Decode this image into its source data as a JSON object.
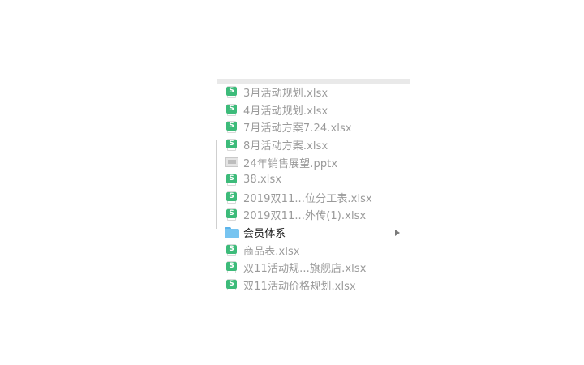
{
  "file_column": {
    "items": [
      {
        "name": "3月活动规划.xlsx",
        "icon": "spreadsheet-icon",
        "icon_glyph": "S"
      },
      {
        "name": "4月活动规划.xlsx",
        "icon": "spreadsheet-icon",
        "icon_glyph": "S"
      },
      {
        "name": "7月活动方案7.24.xlsx",
        "icon": "spreadsheet-icon",
        "icon_glyph": "S"
      },
      {
        "name": "8月活动方案.xlsx",
        "icon": "spreadsheet-icon",
        "icon_glyph": "S"
      },
      {
        "name": "24年销售展望.pptx",
        "icon": "presentation-icon"
      },
      {
        "name": "38.xlsx",
        "icon": "spreadsheet-icon",
        "icon_glyph": "S"
      },
      {
        "name": "2019双11...位分工表.xlsx",
        "icon": "spreadsheet-icon",
        "icon_glyph": "S"
      },
      {
        "name": "2019双11...外传(1).xlsx",
        "icon": "spreadsheet-icon",
        "icon_glyph": "S"
      },
      {
        "name": "会员体系",
        "icon": "folder-icon",
        "has_children": true
      },
      {
        "name": "商品表.xlsx",
        "icon": "spreadsheet-icon",
        "icon_glyph": "S"
      },
      {
        "name": "双11活动规...旗舰店.xlsx",
        "icon": "spreadsheet-icon",
        "icon_glyph": "S"
      },
      {
        "name": "双11活动价格规划.xlsx",
        "icon": "spreadsheet-icon",
        "icon_glyph": "S"
      }
    ]
  },
  "colors": {
    "spreadsheet_badge": "#3dbb7a",
    "folder": "#77c4f0",
    "file_text": "#9a9a9a",
    "folder_text": "#222222"
  }
}
